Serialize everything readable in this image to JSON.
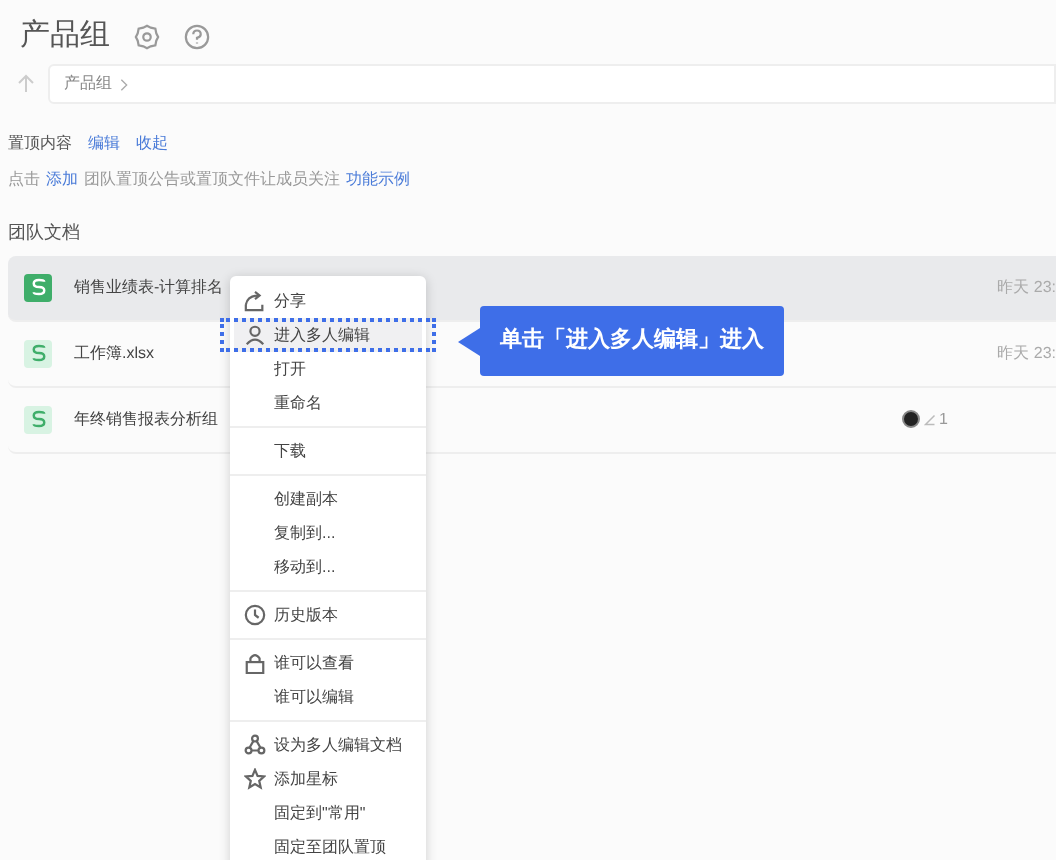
{
  "header": {
    "title": "产品组"
  },
  "breadcrumb": {
    "items": [
      "产品组"
    ]
  },
  "pinned": {
    "title": "置顶内容",
    "actions": [
      "编辑",
      "收起"
    ],
    "hint": {
      "prefix": "点击",
      "link": "添加",
      "text": "团队置顶公告或置顶文件让成员关注",
      "demo": "功能示例"
    }
  },
  "docs": {
    "title": "团队文档",
    "rows": [
      {
        "name": "销售业绩表-计算排名",
        "time": "昨天 23:",
        "selected": true,
        "shared": false
      },
      {
        "name": "工作簿.xlsx",
        "time": "昨天 23:",
        "selected": false,
        "shared": false
      },
      {
        "name": "年终销售报表分析组",
        "selected": false,
        "shared": true,
        "count": "1"
      }
    ]
  },
  "menu": {
    "groups": [
      [
        {
          "label": "分享",
          "kind": "share",
          "selected": false
        },
        {
          "label": "进入多人编辑",
          "kind": "user",
          "selected": true
        },
        {
          "label": "打开",
          "selected": false
        },
        {
          "label": "重命名",
          "selected": false
        }
      ],
      [
        {
          "label": "下载",
          "selected": false
        }
      ],
      [
        {
          "label": "创建副本",
          "selected": false
        },
        {
          "label": "复制到...",
          "selected": false
        },
        {
          "label": "移动到...",
          "selected": false
        }
      ],
      [
        {
          "label": "历史版本",
          "kind": "clock",
          "selected": false
        }
      ],
      [
        {
          "label": "谁可以查看",
          "kind": "lock",
          "selected": false
        },
        {
          "label": "谁可以编辑",
          "selected": false
        }
      ],
      [
        {
          "label": "设为多人编辑文档",
          "kind": "people",
          "selected": false
        },
        {
          "label": "添加星标",
          "kind": "star",
          "selected": false
        },
        {
          "label": "固定到\"常用\"",
          "selected": false
        },
        {
          "label": "固定至团队置顶",
          "selected": false
        }
      ]
    ]
  },
  "callout": {
    "text": "单击「进入多人编辑」进入"
  }
}
